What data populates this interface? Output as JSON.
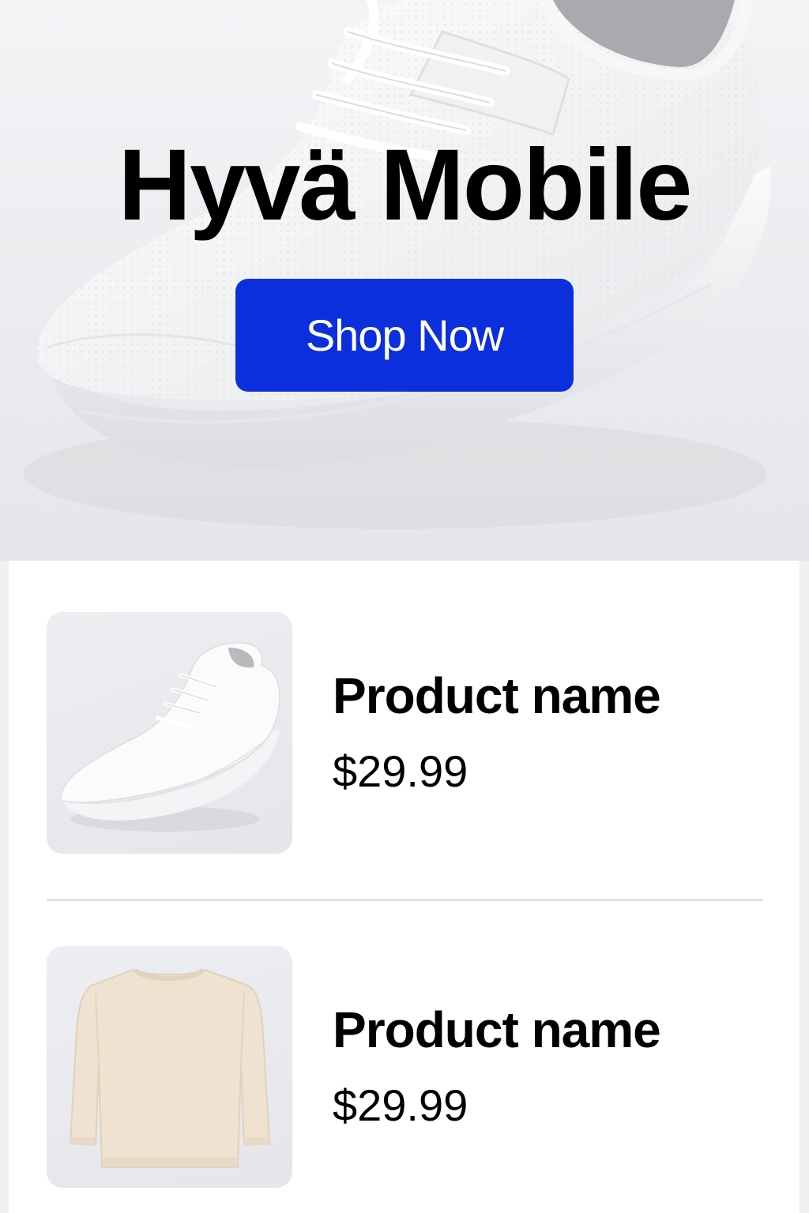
{
  "hero": {
    "title": "Hyvä Mobile",
    "cta_label": "Shop Now",
    "image_icon": "sneaker-hero-image"
  },
  "products": [
    {
      "name": "Product name",
      "price": "$29.99",
      "image_icon": "white-sneaker-image"
    },
    {
      "name": "Product name",
      "price": "$29.99",
      "image_icon": "beige-sweater-image"
    }
  ],
  "colors": {
    "accent": "#0b2fdc",
    "hero_background": "#eeeff1",
    "list_background": "#ffffff",
    "divider": "#e1e2e6",
    "text": "#000000"
  }
}
